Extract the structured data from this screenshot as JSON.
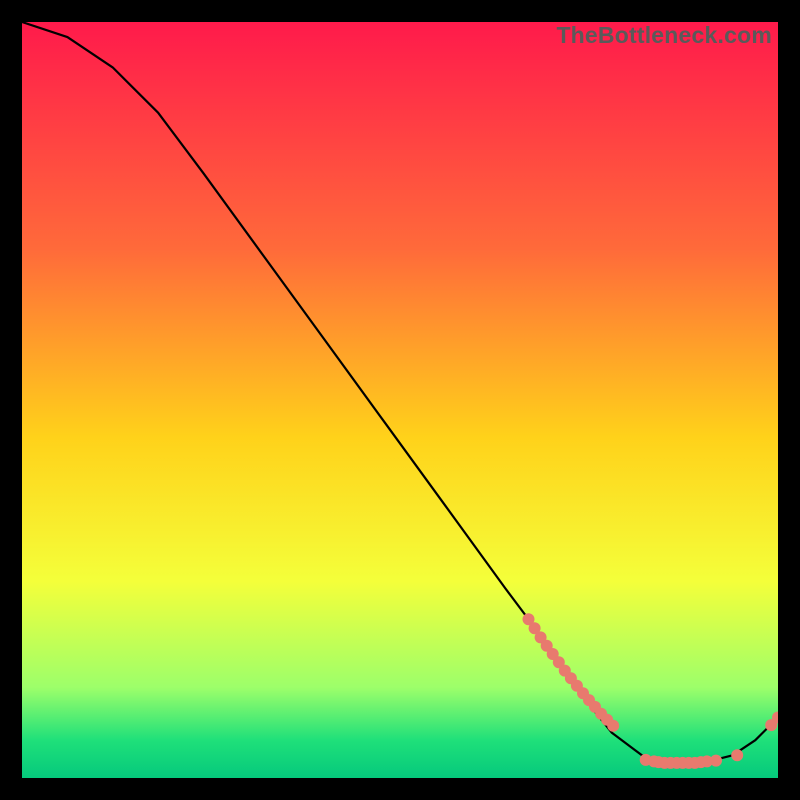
{
  "watermark": "TheBottleneck.com",
  "colors": {
    "gradient_top": "#ff1a4b",
    "gradient_mid_upper": "#ff6a3a",
    "gradient_mid": "#ffd21a",
    "gradient_mid_lower": "#f4ff3a",
    "gradient_green_light": "#9dff6a",
    "gradient_green": "#1fe07a",
    "gradient_green_deep": "#05c97c",
    "curve": "#000000",
    "marker_fill": "#e87a6e",
    "marker_stroke": "#e87a6e"
  },
  "chart_data": {
    "type": "line",
    "title": "",
    "xlabel": "",
    "ylabel": "",
    "xlim": [
      0,
      100
    ],
    "ylim": [
      0,
      100
    ],
    "curve": [
      {
        "x": 0,
        "y": 100
      },
      {
        "x": 6,
        "y": 98
      },
      {
        "x": 12,
        "y": 94
      },
      {
        "x": 18,
        "y": 88
      },
      {
        "x": 24,
        "y": 80
      },
      {
        "x": 32,
        "y": 69
      },
      {
        "x": 40,
        "y": 58
      },
      {
        "x": 48,
        "y": 47
      },
      {
        "x": 56,
        "y": 36
      },
      {
        "x": 64,
        "y": 25
      },
      {
        "x": 70,
        "y": 17
      },
      {
        "x": 74,
        "y": 11
      },
      {
        "x": 78,
        "y": 6
      },
      {
        "x": 82,
        "y": 3
      },
      {
        "x": 86,
        "y": 2
      },
      {
        "x": 90,
        "y": 2
      },
      {
        "x": 94,
        "y": 3
      },
      {
        "x": 97,
        "y": 5
      },
      {
        "x": 100,
        "y": 8
      }
    ],
    "markers_descending": [
      {
        "x": 67.0,
        "y": 21.0
      },
      {
        "x": 67.8,
        "y": 19.8
      },
      {
        "x": 68.6,
        "y": 18.6
      },
      {
        "x": 69.4,
        "y": 17.5
      },
      {
        "x": 70.2,
        "y": 16.4
      },
      {
        "x": 71.0,
        "y": 15.3
      },
      {
        "x": 71.8,
        "y": 14.2
      },
      {
        "x": 72.6,
        "y": 13.2
      },
      {
        "x": 73.4,
        "y": 12.2
      },
      {
        "x": 74.2,
        "y": 11.2
      },
      {
        "x": 75.0,
        "y": 10.3
      },
      {
        "x": 75.8,
        "y": 9.4
      },
      {
        "x": 76.6,
        "y": 8.5
      },
      {
        "x": 77.4,
        "y": 7.7
      },
      {
        "x": 78.2,
        "y": 6.9
      }
    ],
    "markers_bottom": [
      {
        "x": 82.5,
        "y": 2.4
      },
      {
        "x": 83.6,
        "y": 2.2
      },
      {
        "x": 84.2,
        "y": 2.1
      },
      {
        "x": 85.0,
        "y": 2.0
      },
      {
        "x": 85.8,
        "y": 2.0
      },
      {
        "x": 86.6,
        "y": 2.0
      },
      {
        "x": 87.4,
        "y": 2.0
      },
      {
        "x": 88.2,
        "y": 2.0
      },
      {
        "x": 89.0,
        "y": 2.0
      },
      {
        "x": 89.8,
        "y": 2.1
      },
      {
        "x": 90.6,
        "y": 2.2
      },
      {
        "x": 91.8,
        "y": 2.3
      },
      {
        "x": 94.6,
        "y": 3.0
      }
    ],
    "markers_rising": [
      {
        "x": 99.1,
        "y": 7.0
      },
      {
        "x": 100.0,
        "y": 8.0
      }
    ]
  }
}
